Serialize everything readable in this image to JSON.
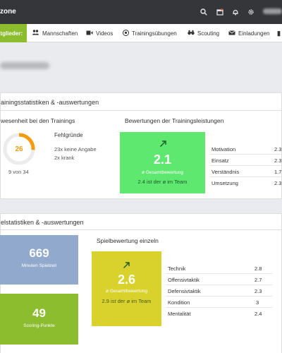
{
  "topbar": {
    "brand": "zone"
  },
  "nav": {
    "active": "itglieder",
    "items": [
      "Mannschaften",
      "Videos",
      "Trainingsübungen",
      "Scouting",
      "Einladungen"
    ]
  },
  "training_section": {
    "title": "ainingsstatistiken & -auswertungen",
    "attendance": {
      "heading": "wesenheit bei den Trainings",
      "percent_value": 26,
      "fill_fraction": 0.26,
      "count_text": "9 von 34",
      "reasons_title": "Fehlgründe",
      "reasons": [
        "23x keine Angabe",
        "2x krank"
      ]
    },
    "ratings": {
      "heading": "Bewertungen der Trainingsleistungen",
      "score": "2.1",
      "score_label": "ø Gesamtbewertung",
      "comparison": "2.4 ist der ø im Team",
      "criteria": [
        {
          "label": "Motivation",
          "value": "2.3"
        },
        {
          "label": "Einsatz",
          "value": "2.3"
        },
        {
          "label": "Verständnis",
          "value": "1.7"
        },
        {
          "label": "Umsetzung",
          "value": "2.3"
        }
      ]
    }
  },
  "game_section": {
    "title": "elstatistiken & -auswertungen",
    "minutes": {
      "value": "669",
      "label": "Minuten Spielzeit"
    },
    "scoring": {
      "value": "49",
      "label": "Scoring-Punkte"
    },
    "ratings": {
      "heading": "Spielbewertung einzeln",
      "score": "2.6",
      "score_label": "ø Gesamtbewertung",
      "comparison": "2.9 ist der ø im Team",
      "criteria": [
        {
          "label": "Technik",
          "value": "2.8"
        },
        {
          "label": "Offensivtaktik",
          "value": "2.7"
        },
        {
          "label": "Defensivtaktik",
          "value": "2.3"
        },
        {
          "label": "Kondition",
          "value": "3"
        },
        {
          "label": "Mentalität",
          "value": "2.4"
        }
      ]
    }
  },
  "colors": {
    "accent_green": "#8bbd2f",
    "training_score_bg": "#5ee870",
    "game_score_bg": "#d9d22c",
    "minutes_bg": "#90a9cc",
    "scoring_bg": "#8bbd2f",
    "donut_fill": "#f39c12",
    "donut_track": "#ececec"
  },
  "icons": {
    "topbar": [
      "search-icon",
      "calendar-icon",
      "bell-icon",
      "gear-icon"
    ],
    "nav": [
      "users-icon",
      "video-icon",
      "soccer-ball-icon",
      "binoculars-icon",
      "envelope-icon"
    ],
    "trend": "arrow-up-right-icon"
  }
}
